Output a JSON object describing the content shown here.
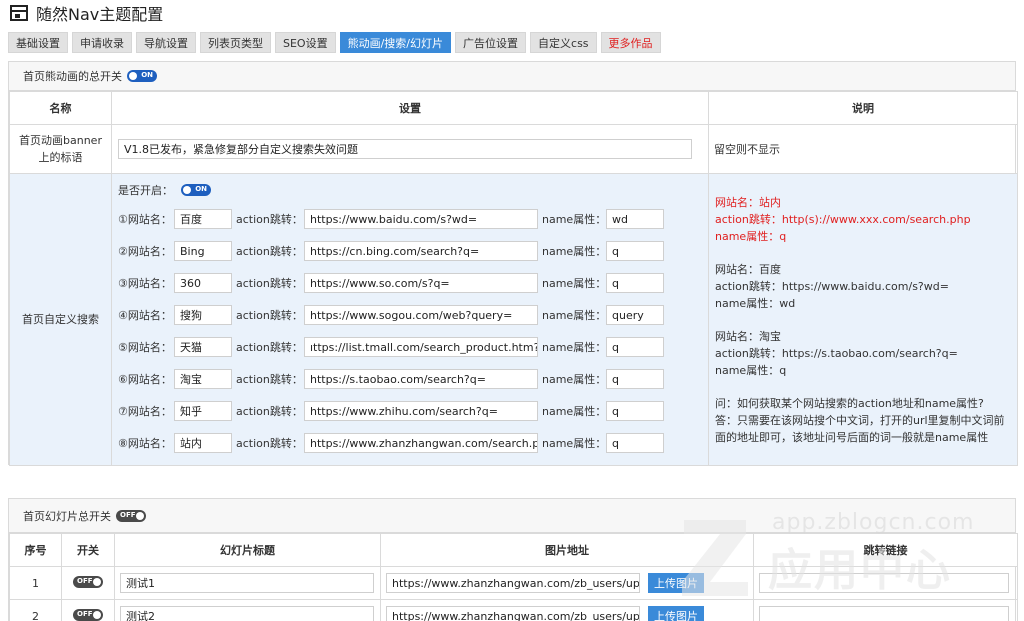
{
  "app": {
    "title": "随然Nav主题配置"
  },
  "tabs": [
    {
      "label": "基础设置"
    },
    {
      "label": "申请收录"
    },
    {
      "label": "导航设置"
    },
    {
      "label": "列表页类型"
    },
    {
      "label": "SEO设置"
    },
    {
      "label": "熊动画/搜索/幻灯片",
      "active": true
    },
    {
      "label": "广告位设置"
    },
    {
      "label": "自定义css"
    },
    {
      "label": "更多作品",
      "accent": true
    }
  ],
  "section1": {
    "title": "首页熊动画的总开关",
    "toggle": "ON",
    "columns": [
      "名称",
      "设置",
      "说明"
    ],
    "banner": {
      "label": "首页动画banner上的标语",
      "value": "V1.8已发布，紧急修复部分自定义搜索失效问题",
      "note": "留空则不显示"
    },
    "search": {
      "label": "首页自定义搜索",
      "open_label": "是否开启：",
      "open_toggle": "ON",
      "sites": [
        {
          "prefix": "①网站名：",
          "name": "百度",
          "action_label": "action跳转：",
          "action": "https://www.baidu.com/s?wd=",
          "attr_label": "name属性：",
          "attr": "wd"
        },
        {
          "prefix": "②网站名：",
          "name": "Bing",
          "action_label": "action跳转：",
          "action": "https://cn.bing.com/search?q=",
          "attr_label": "name属性：",
          "attr": "q"
        },
        {
          "prefix": "③网站名：",
          "name": "360",
          "action_label": "action跳转：",
          "action": "https://www.so.com/s?q=",
          "attr_label": "name属性：",
          "attr": "q"
        },
        {
          "prefix": "④网站名：",
          "name": "搜狗",
          "action_label": "action跳转：",
          "action": "https://www.sogou.com/web?query=",
          "attr_label": "name属性：",
          "attr": "query"
        },
        {
          "prefix": "⑤网站名：",
          "name": "天猫",
          "action_label": "action跳转：",
          "action": "ıttps://list.tmall.com/search_product.htm?q=",
          "attr_label": "name属性：",
          "attr": "q"
        },
        {
          "prefix": "⑥网站名：",
          "name": "淘宝",
          "action_label": "action跳转：",
          "action": "https://s.taobao.com/search?q=",
          "attr_label": "name属性：",
          "attr": "q"
        },
        {
          "prefix": "⑦网站名：",
          "name": "知乎",
          "action_label": "action跳转：",
          "action": "https://www.zhihu.com/search?q=",
          "attr_label": "name属性：",
          "attr": "q"
        },
        {
          "prefix": "⑧网站名：",
          "name": "站内",
          "action_label": "action跳转：",
          "action": "https://www.zhanzhangwan.com/search.php",
          "attr_label": "name属性：",
          "attr": "q"
        }
      ],
      "help": {
        "example_red": [
          "网站名：站内",
          "action跳转：http(s)://www.xxx.com/search.php",
          "name属性：q"
        ],
        "example_baidu": [
          "网站名：百度",
          "action跳转：https://www.baidu.com/s?wd=",
          "name属性：wd"
        ],
        "example_taobao": [
          "网站名：淘宝",
          "action跳转：https://s.taobao.com/search?q=",
          "name属性：q"
        ],
        "faq": [
          "问：如何获取某个网站搜索的action地址和name属性?",
          "答：只需要在该网站搜个中文词，打开的url里复制中文词前面的地址即可，该地址问号后面的词一般就是name属性"
        ]
      }
    }
  },
  "section2": {
    "title": "首页幻灯片总开关",
    "toggle": "OFF",
    "columns": [
      "序号",
      "开关",
      "幻灯片标题",
      "图片地址",
      "跳转链接"
    ],
    "rows": [
      {
        "index": "1",
        "toggle": "OFF",
        "title": "测试1",
        "image": "https://www.zhanzhangwan.com/zb_users/uplo",
        "upload": "上传图片"
      },
      {
        "index": "2",
        "toggle": "OFF",
        "title": "测试2",
        "image": "https://www.zhanzhangwan.com/zb_users/uplo",
        "upload": "上传图片"
      }
    ]
  },
  "watermark": {
    "url": "app.zblogcn.com",
    "text": "应用中心"
  }
}
